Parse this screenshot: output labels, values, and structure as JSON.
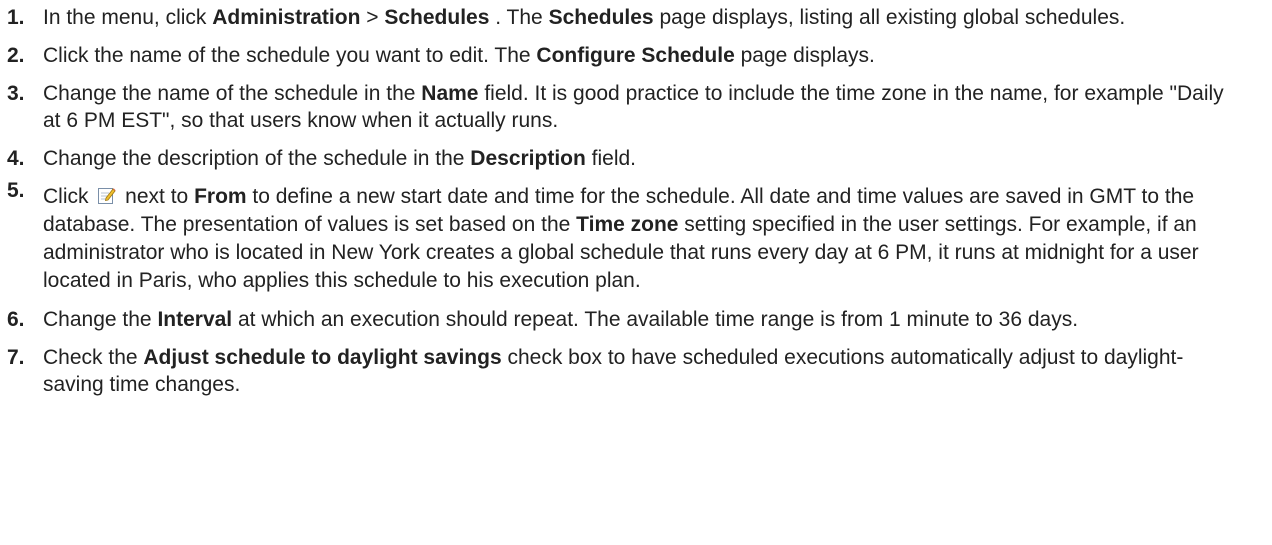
{
  "steps": [
    {
      "number": "1.",
      "parts": {
        "a": "In the menu, click ",
        "b": "Administration",
        "c": " > ",
        "d": "Schedules",
        "e": " . The ",
        "f": "Schedules",
        "g": " page displays, listing all existing global schedules."
      }
    },
    {
      "number": "2.",
      "parts": {
        "a": "Click the name of the schedule you want to edit. The ",
        "b": "Configure Schedule",
        "c": " page displays."
      }
    },
    {
      "number": "3.",
      "parts": {
        "a": "Change the name of the schedule in the ",
        "b": "Name",
        "c": " field. It is good practice to include the time zone in the name, for example \"Daily at 6 PM EST\", so that users know when it actually runs."
      }
    },
    {
      "number": "4.",
      "parts": {
        "a": "Change the description of the schedule in the ",
        "b": "Description",
        "c": " field."
      }
    },
    {
      "number": "5.",
      "parts": {
        "a": "Click ",
        "icon": "edit-icon",
        "b": " next to ",
        "c": "From",
        "d": " to define a new start date and time for the schedule. All date and time values are saved in GMT to the database. The presentation of values is set based on the ",
        "e": "Time zone",
        "f": " setting specified in the user settings. For example, if an administrator who is located in New York creates a global schedule that runs every day at 6 PM, it runs at midnight for a user located in Paris, who applies this schedule to his execution plan."
      }
    },
    {
      "number": "6.",
      "parts": {
        "a": "Change the ",
        "b": "Interval",
        "c": " at which an execution should repeat. The available time range is from 1 minute to 36 days."
      }
    },
    {
      "number": "7.",
      "parts": {
        "a": "Check the ",
        "b": "Adjust schedule to daylight savings",
        "c": " check box to have scheduled executions automatically adjust to daylight-saving time changes."
      }
    }
  ]
}
